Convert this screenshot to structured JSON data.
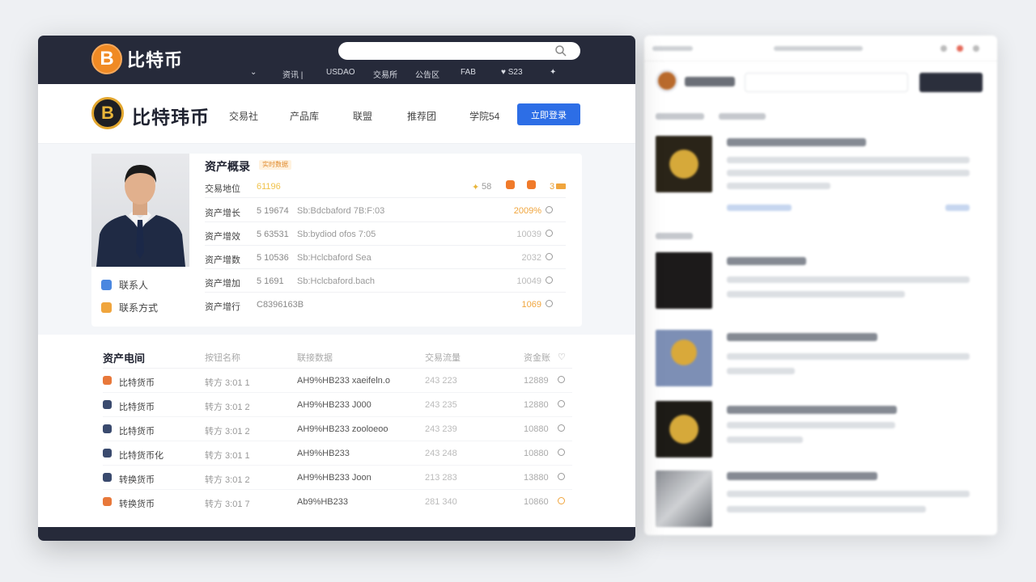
{
  "colors": {
    "topbar_bg": "#262a3a",
    "accent_blue": "#2d6ee6",
    "coin_orange": "#f08a24",
    "coin_gold": "#e3a72f",
    "highlight_orange": "#f0a53d"
  },
  "header": {
    "brand_text": "比特币",
    "brand_icon": "bitcoin-coin-icon",
    "search": {
      "placeholder": "",
      "icon": "search-icon"
    },
    "links": [
      "资讯 |",
      "USDAO",
      "交易所",
      "公告区",
      "FAB",
      "♥ S23",
      "✦",
      "⌄"
    ]
  },
  "nav": {
    "brand_text": "比特玮币",
    "items": [
      "交易社",
      "产品库",
      "联盟",
      "推荐团",
      "学院54"
    ],
    "cta_label": "立即登录"
  },
  "profile": {
    "contacts": [
      {
        "label": "联系人",
        "icon": "person-icon"
      },
      {
        "label": "联系方式",
        "icon": "phone-icon"
      }
    ]
  },
  "summary": {
    "title": "资产概录",
    "tag": "实时数据",
    "top_row": {
      "label": "交易地位",
      "value": "61196",
      "stats": [
        "58",
        "",
        "",
        "3"
      ]
    },
    "rows": [
      {
        "label": "资产增长",
        "num": "5 19674",
        "desc": "Sb:Bdcbaford 7B:F:03",
        "value": "2009%",
        "highlight": true
      },
      {
        "label": "资产增效",
        "num": "5 63531",
        "desc": "Sb:bydiod ofos 7:05",
        "value": "10039",
        "highlight": false
      },
      {
        "label": "资产增数",
        "num": "5 10536",
        "desc": "Sb:Hclcbaford Sea",
        "value": "2032",
        "highlight": false
      },
      {
        "label": "资产增加",
        "num": "5 1691",
        "desc": "Sb:Hclcbaford.bach",
        "value": "10049",
        "highlight": false
      },
      {
        "label": "资产增行",
        "num": "C8396163B",
        "desc": "",
        "value": "1069",
        "highlight": true
      }
    ]
  },
  "flows": {
    "title": "资产电间",
    "headers": [
      "按钮名称",
      "联接数据",
      "交易流量",
      "资金账"
    ],
    "rows": [
      {
        "name": "比特货币",
        "date": "转方 3:01 1",
        "hash": "AH9%HB233  xaeifeln.o",
        "vol": "243 223",
        "value": "12889",
        "color": "#e8783a"
      },
      {
        "name": "比特货币",
        "date": "转方 3:01 2",
        "hash": "AH9%HB233  J000",
        "vol": "243 235",
        "value": "12880",
        "color": "#3a4a6e"
      },
      {
        "name": "比特货币",
        "date": "转方 3:01 2",
        "hash": "AH9%HB233  zooloeoo",
        "vol": "243 239",
        "value": "10880",
        "color": "#3a4a6e"
      },
      {
        "name": "比特货币化",
        "date": "转方 3:01 1",
        "hash": "AH9%HB233",
        "vol": "243 248",
        "value": "10880",
        "color": "#3a4a6e"
      },
      {
        "name": "转换货币",
        "date": "转方 3:01 2",
        "hash": "AH9%HB233  Joon",
        "vol": "213 283",
        "value": "13880",
        "color": "#3a4a6e"
      },
      {
        "name": "转换货币",
        "date": "转方 3:01 7",
        "hash": "Ab9%HB233",
        "vol": "281 340",
        "value": "10860",
        "color": "#e8783a"
      }
    ]
  }
}
